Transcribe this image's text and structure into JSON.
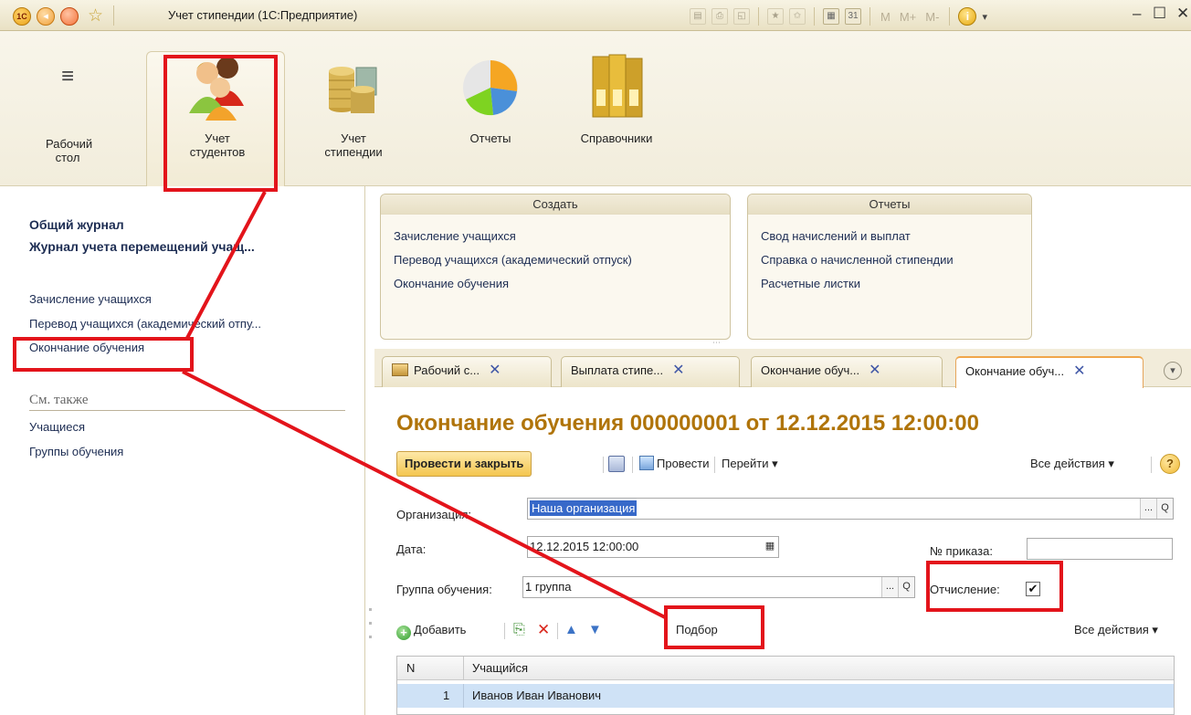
{
  "window": {
    "title": "Учет стипендии (1С:Предприятие)",
    "logo": "1С",
    "memory_buttons": [
      "M",
      "M+",
      "M-"
    ],
    "info_label": "i"
  },
  "sections": [
    {
      "label_line1": "Рабочий",
      "label_line2": "стол",
      "icon": "hamburger-icon"
    },
    {
      "label_line1": "Учет",
      "label_line2": "студентов",
      "icon": "students-icon"
    },
    {
      "label_line1": "Учет",
      "label_line2": "стипендии",
      "icon": "coins-icon"
    },
    {
      "label_line1": "Отчеты",
      "label_line2": "",
      "icon": "pie-chart-icon"
    },
    {
      "label_line1": "Справочники",
      "label_line2": "",
      "icon": "binders-icon"
    }
  ],
  "leftnav": {
    "journals": [
      "Общий журнал",
      "Журнал учета перемещений учащ..."
    ],
    "documents": [
      "Зачисление учащихся",
      "Перевод учащихся (академический отпу...",
      "Окончание обучения"
    ],
    "see_also_title": "См. также",
    "see_also": [
      "Учащиеся",
      "Группы обучения"
    ]
  },
  "groups": {
    "create": {
      "title": "Создать",
      "items": [
        "Зачисление учащихся",
        "Перевод учащихся (академический отпуск)",
        "Окончание обучения"
      ]
    },
    "reports": {
      "title": "Отчеты",
      "items": [
        "Свод начислений и выплат",
        "Справка о начисленной стипендии",
        "Расчетные листки"
      ]
    }
  },
  "tabs": [
    {
      "label": "Рабочий с...",
      "close": "✕"
    },
    {
      "label": "Выплата стипе...",
      "close": "✕"
    },
    {
      "label": "Окончание обуч...",
      "close": "✕"
    },
    {
      "label": "Окончание обуч...",
      "close": "✕"
    }
  ],
  "document": {
    "title": "Окончание обучения 000000001 от 12.12.2015 12:00:00",
    "toolbar": {
      "post_close": "Провести и закрыть",
      "post": "Провести",
      "goto": "Перейти ▾",
      "all_actions": "Все действия ▾",
      "help": "?"
    },
    "fields": {
      "organization_label": "Организация:",
      "organization_value": "Наша организация",
      "date_label": "Дата:",
      "date_value": "12.12.2015 12:00:00",
      "order_label": "№ приказа:",
      "order_value": "",
      "group_label": "Группа обучения:",
      "group_value": "1 группа",
      "expel_label": "Отчисление:",
      "expel_checked": "✔",
      "ellipsis": "...",
      "search": "Q"
    },
    "table_toolbar": {
      "add": "Добавить",
      "pick": "Подбор",
      "all_actions": "Все действия ▾"
    },
    "table": {
      "columns": [
        "N",
        "Учащийся"
      ],
      "rows": [
        {
          "n": "1",
          "student": "Иванов Иван Иванович"
        }
      ]
    }
  },
  "colors": {
    "highlight": "#e3141b",
    "doc_title": "#b0740a",
    "selection": "#3769c9"
  }
}
